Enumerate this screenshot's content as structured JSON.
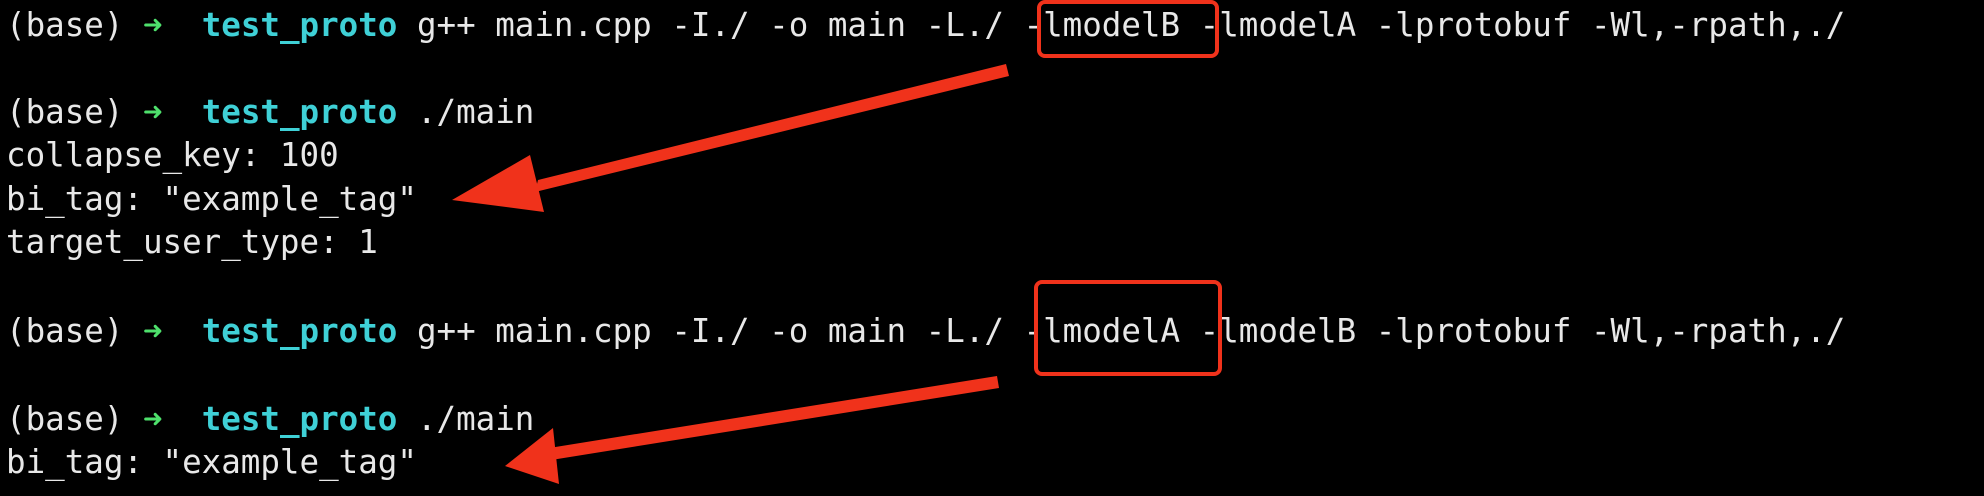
{
  "terminal": {
    "colors": {
      "background": "#000000",
      "text": "#e8e8e8",
      "prompt_arrow": "#4ee06c",
      "directory": "#3fd0d6",
      "annotation": "#f0321b"
    },
    "lines": [
      {
        "env": "(base)",
        "arrow": "➜",
        "dir": "test_proto",
        "cmd_before": "g++ main.cpp -I./ -o main -L./ ",
        "cmd_highlight": "-lmodelB",
        "cmd_after": " -lmodelA -lprotobuf -Wl,-rpath,./"
      },
      {
        "env": "(base)",
        "arrow": "➜",
        "dir": "test_proto",
        "cmd": "./main"
      },
      {
        "text": "collapse_key: 100"
      },
      {
        "text": "bi_tag: \"example_tag\""
      },
      {
        "text": "target_user_type: 1"
      },
      {
        "env": "(base)",
        "arrow": "➜",
        "dir": "test_proto",
        "cmd_before": "g++ main.cpp -I./ -o main -L./ ",
        "cmd_highlight": "-lmodelA",
        "cmd_after": " -lmodelB -lprotobuf -Wl,-rpath,./"
      },
      {
        "env": "(base)",
        "arrow": "➜",
        "dir": "test_proto",
        "cmd": "./main"
      },
      {
        "text": "bi_tag: \"example_tag\""
      }
    ]
  }
}
